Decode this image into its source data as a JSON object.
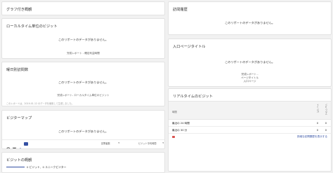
{
  "empty_message": "このリポートのデータがありません。",
  "left": {
    "card1": {
      "title": "グラフ付き概観"
    },
    "card2": {
      "title": "ローカルタイム単位のビジット",
      "link": "完成レポート - 確定利益時間"
    },
    "card3": {
      "title": "曜日別訪問数",
      "link": "完成レポート- ローカルタイム単位のビジット",
      "footnote": "このレポートは、2019-01-12 のデータを使用して生成しました。"
    },
    "card4": {
      "title": "ビジターマップ",
      "select1": "訪問者数",
      "select2": "ビジット平均時間"
    },
    "card5": {
      "title": "ビジットの概観",
      "metric": "0 ビジット、0 ユニークビジター"
    }
  },
  "right": {
    "card1": {
      "title": "訪問履歴"
    },
    "card2": {
      "title": "入口ページタイトル",
      "links": [
        "完成レポート -",
        "ページタイトル",
        "入口ページ"
      ]
    },
    "card3": {
      "title": "リアルタイムのビジット",
      "col_label": "時間",
      "col_visits": "ビジット",
      "col_actions": "アクション",
      "rows": [
        {
          "label": "最近の 24 時間",
          "visits": "0",
          "actions": "0"
        },
        {
          "label": "最近の 30 分",
          "visits": "0",
          "actions": "0"
        }
      ],
      "link": "詳細な訪問履歴を表示する"
    }
  },
  "colors": {
    "accent": "#3450a3",
    "alert": "#d9534f"
  }
}
